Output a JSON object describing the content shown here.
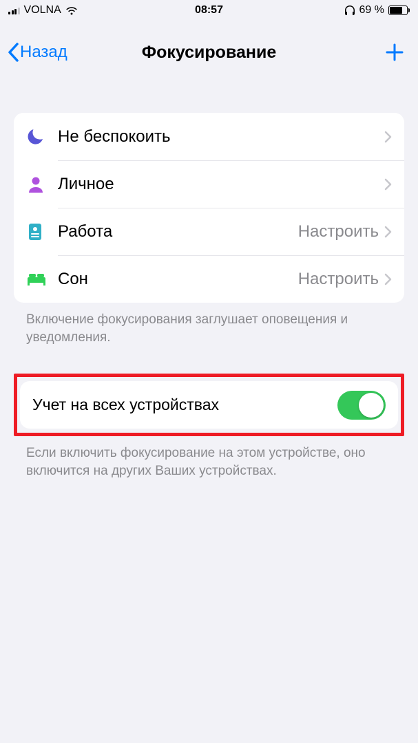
{
  "status": {
    "carrier": "VOLNA",
    "time": "08:57",
    "battery_pct": "69 %"
  },
  "nav": {
    "back": "Назад",
    "title": "Фокусирование"
  },
  "focus_modes": [
    {
      "label": "Не беспокоить",
      "detail": ""
    },
    {
      "label": "Личное",
      "detail": ""
    },
    {
      "label": "Работа",
      "detail": "Настроить"
    },
    {
      "label": "Сон",
      "detail": "Настроить"
    }
  ],
  "footer1": "Включение фокусирования заглушает оповещения и уведомления.",
  "share": {
    "label": "Учет на всех устройствах",
    "on": true
  },
  "footer2": "Если включить фокусирование на этом устройстве, оно включится на других Ваших устройствах."
}
